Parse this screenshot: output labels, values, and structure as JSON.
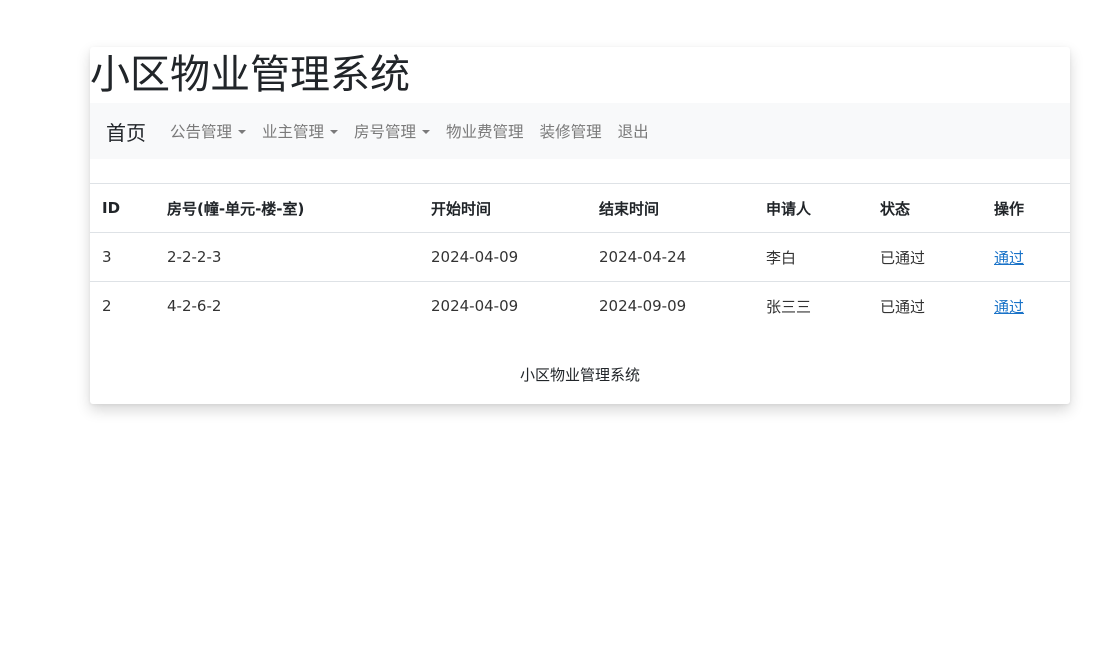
{
  "header": {
    "title": "小区物业管理系统"
  },
  "nav": {
    "brand": "首页",
    "items": [
      {
        "label": "公告管理",
        "dropdown": true
      },
      {
        "label": "业主管理",
        "dropdown": true
      },
      {
        "label": "房号管理",
        "dropdown": true
      },
      {
        "label": "物业费管理",
        "dropdown": false
      },
      {
        "label": "装修管理",
        "dropdown": false
      },
      {
        "label": "退出",
        "dropdown": false
      }
    ]
  },
  "table": {
    "columns": [
      "ID",
      "房号(幢-单元-楼-室)",
      "开始时间",
      "结束时间",
      "申请人",
      "状态",
      "操作"
    ],
    "rows": [
      {
        "id": "3",
        "room": "2-2-2-3",
        "start": "2024-04-09",
        "end": "2024-04-24",
        "applicant": "李白",
        "status": "已通过",
        "action": "通过"
      },
      {
        "id": "2",
        "room": "4-2-6-2",
        "start": "2024-04-09",
        "end": "2024-09-09",
        "applicant": "张三三",
        "status": "已通过",
        "action": "通过"
      }
    ]
  },
  "footer": {
    "text": "小区物业管理系统"
  },
  "colors": {
    "navbar_bg": "#f8f9fa",
    "link": "#1a73c8",
    "nav_text": "#7a7a7a"
  }
}
